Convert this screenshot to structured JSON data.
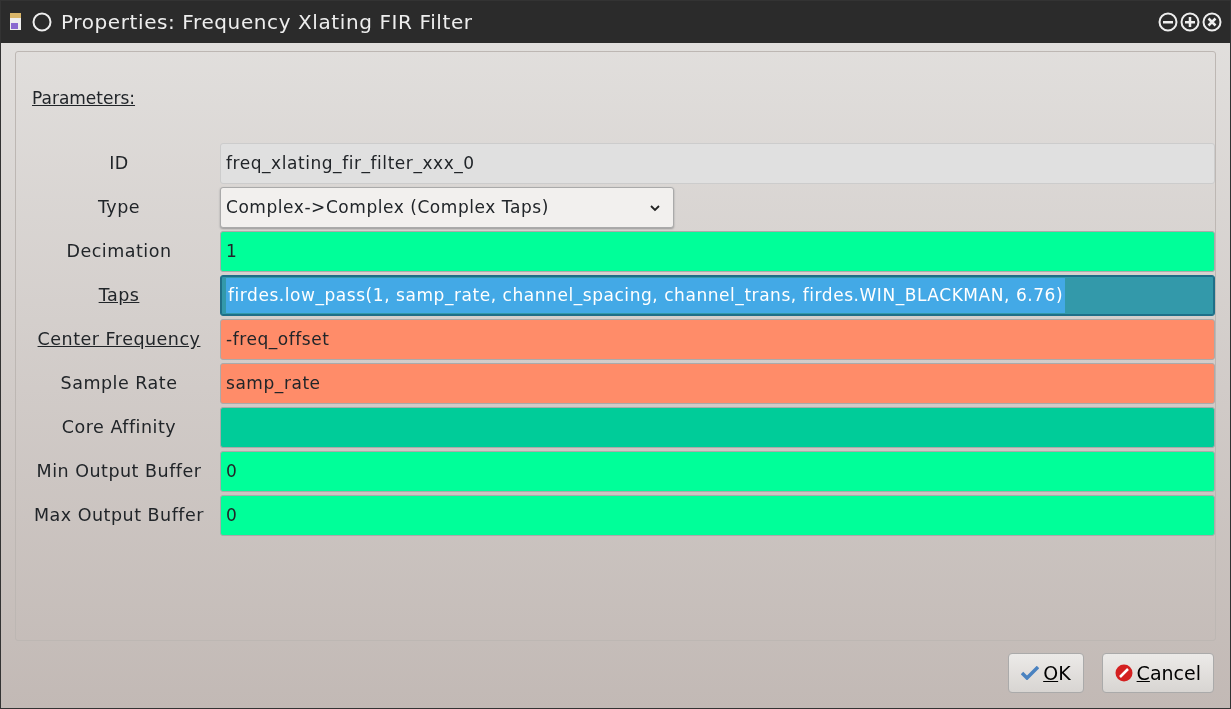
{
  "window": {
    "title": "Properties: Frequency Xlating FIR Filter"
  },
  "section": {
    "heading": "Parameters:"
  },
  "params": [
    {
      "label": "ID",
      "underlined": false,
      "kind": "readonly",
      "value": "freq_xlating_fir_filter_xxx_0",
      "color": "#e0e0e0",
      "selected": false
    },
    {
      "label": "Type",
      "underlined": false,
      "kind": "dropdown",
      "value": "Complex->Complex (Complex Taps)",
      "color": "#f2f0ee",
      "selected": false
    },
    {
      "label": "Decimation",
      "underlined": false,
      "kind": "entry",
      "value": "1",
      "color": "#00ff99",
      "selected": false
    },
    {
      "label": "Taps",
      "underlined": true,
      "kind": "entry",
      "value": "firdes.low_pass(1, samp_rate, channel_spacing, channel_trans, firdes.WIN_BLACKMAN, 6.76)",
      "color": "#3399aa",
      "selected": true
    },
    {
      "label": "Center Frequency",
      "underlined": true,
      "kind": "entry",
      "value": "-freq_offset",
      "color": "#ff8c69",
      "selected": false
    },
    {
      "label": "Sample Rate",
      "underlined": false,
      "kind": "entry",
      "value": "samp_rate",
      "color": "#ff8c69",
      "selected": false
    },
    {
      "label": "Core Affinity",
      "underlined": false,
      "kind": "entry",
      "color": "#00cc99",
      "selected": false
    },
    {
      "label": "Min Output Buffer",
      "underlined": false,
      "kind": "entry",
      "value": "0",
      "color": "#00ff99",
      "selected": false
    },
    {
      "label": "Max Output Buffer",
      "underlined": false,
      "kind": "entry",
      "value": "0",
      "color": "#00ff99",
      "selected": false
    }
  ],
  "buttons": [
    {
      "kind": "ok",
      "mnemonic": "O",
      "rest": "K"
    },
    {
      "kind": "cancel",
      "mnemonic": "C",
      "rest": "ancel"
    }
  ]
}
